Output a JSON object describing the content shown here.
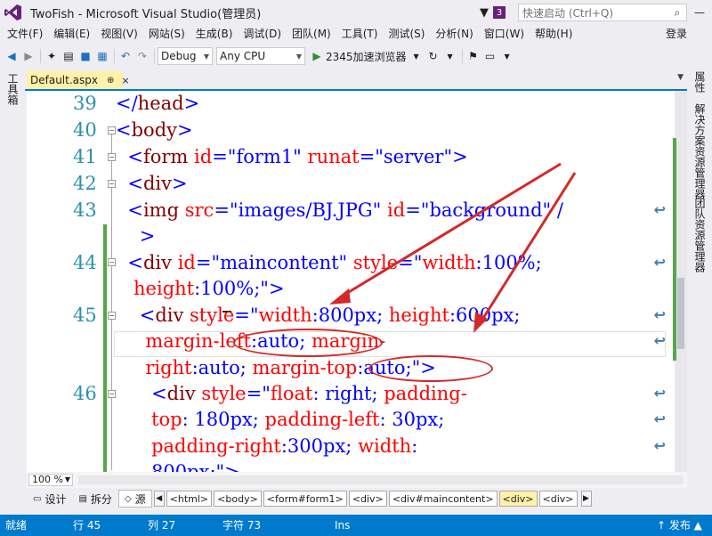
{
  "window": {
    "title": "TwoFish - Microsoft Visual Studio(管理员)",
    "notification_count": "3",
    "quick_launch_placeholder": "快速启动 (Ctrl+Q)",
    "minimize": "—"
  },
  "menu": {
    "items": [
      "文件(F)",
      "编辑(E)",
      "视图(V)",
      "网站(S)",
      "生成(B)",
      "调试(D)",
      "团队(M)",
      "工具(T)",
      "测试(S)",
      "分析(N)",
      "窗口(W)",
      "帮助(H)"
    ],
    "login": "登录"
  },
  "toolbar": {
    "config": "Debug",
    "platform": "Any CPU",
    "run_target": "2345加速浏览器"
  },
  "left_tools": {
    "toolbox": "工具箱"
  },
  "right_tools": [
    "属性",
    "解决方案资源管理器",
    "团队资源管理器"
  ],
  "doc_tab": {
    "name": "Default.aspx",
    "pin": "⊕",
    "close": "×"
  },
  "editor": {
    "line_numbers": [
      "39",
      "40",
      "41",
      "42",
      "43",
      "44",
      "45",
      "46"
    ]
  },
  "zoom": {
    "level": "100 %"
  },
  "views": {
    "design": "设计",
    "split": "拆分",
    "source": "源"
  },
  "breadcrumb": [
    "<html>",
    "<body>",
    "<form#form1>",
    "<div>",
    "<div#maincontent>",
    "<div>",
    "<div>"
  ],
  "status": {
    "ready": "就绪",
    "row": "行 45",
    "col": "列 27",
    "char": "字符 73",
    "ins": "Ins",
    "publish": "↑ 发布 ▲"
  },
  "accent_color": "#007acc",
  "brand_color": "#68217a",
  "annotation_color": "#d42929"
}
